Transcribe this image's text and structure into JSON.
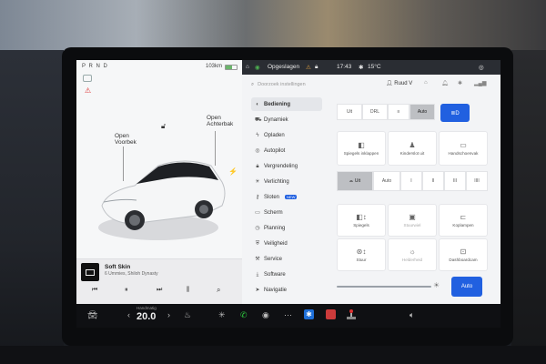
{
  "gear": "P R N D",
  "range": "103km",
  "left": {
    "open_frunk": "Open\nVoorbek",
    "open_trunk": "Open\nAchterbak"
  },
  "media": {
    "title": "Soft Skin",
    "artist": "6 Ummies, Shiloh Dynasty"
  },
  "status": {
    "action": "Opgeslagen",
    "time": "17:43",
    "temp": "15°C",
    "profile": "Ruud V",
    "search_placeholder": "Doorzoek instellingen"
  },
  "menu": [
    {
      "label": "Bediening",
      "icon": "toggle-icon"
    },
    {
      "label": "Dynamiek",
      "icon": "car-icon"
    },
    {
      "label": "Opladen",
      "icon": "bolt-icon"
    },
    {
      "label": "Autopilot",
      "icon": "steering-icon"
    },
    {
      "label": "Vergrendeling",
      "icon": "lock-icon"
    },
    {
      "label": "Verlichting",
      "icon": "light-icon"
    },
    {
      "label": "Sloten",
      "icon": "key-icon"
    },
    {
      "label": "Scherm",
      "icon": "screen-icon"
    },
    {
      "label": "Planning",
      "icon": "clock-icon"
    },
    {
      "label": "Veiligheid",
      "icon": "shield-icon"
    },
    {
      "label": "Service",
      "icon": "wrench-icon"
    },
    {
      "label": "Software",
      "icon": "download-icon"
    },
    {
      "label": "Navigatie",
      "icon": "nav-icon"
    }
  ],
  "new_badge": "NEW",
  "controls": {
    "lights_auto": "Auto",
    "lights_options": [
      "Uit",
      "DRL",
      "",
      "Auto"
    ],
    "tile_row1": [
      "Spiegels inklappen",
      "Kinderslot uit",
      "Handschoenvak"
    ],
    "wiper_options": [
      "Uit",
      "Auto",
      "I",
      "II",
      "III",
      "IIII"
    ],
    "tile_row2": [
      "Spiegels",
      "Stuurwiel",
      "Koplampen"
    ],
    "tile_row3": [
      "Stuur",
      "Helderheid",
      "Dashboardcam"
    ],
    "auto_button": "Auto"
  },
  "taskbar": {
    "temp": "20.0",
    "temp_label": "Handmatig"
  }
}
